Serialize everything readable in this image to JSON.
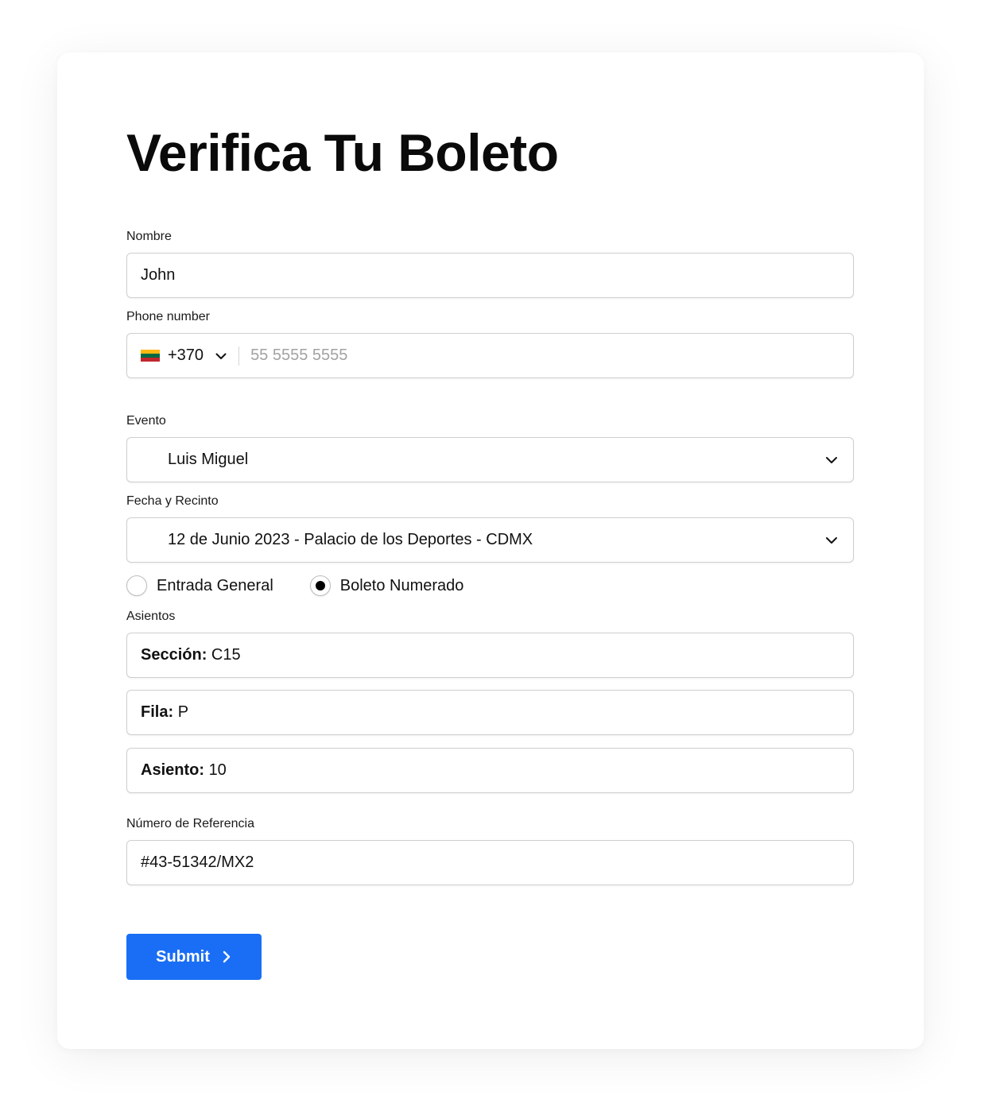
{
  "form": {
    "title": "Verifica Tu Boleto",
    "nombre": {
      "label": "Nombre",
      "value": "John"
    },
    "phone": {
      "label": "Phone number",
      "country_code": "+370",
      "flag_icon": "lithuania-flag-icon",
      "flag_colors": [
        "#fdb913",
        "#006a44",
        "#c1272d"
      ],
      "placeholder": "55 5555 5555"
    },
    "evento": {
      "label": "Evento",
      "value": "Luis Miguel"
    },
    "fecha": {
      "label": "Fecha y Recinto",
      "value": "12 de Junio 2023 - Palacio de los Deportes - CDMX"
    },
    "ticket_type": {
      "options": [
        {
          "label": "Entrada General",
          "selected": false
        },
        {
          "label": "Boleto Numerado",
          "selected": true
        }
      ]
    },
    "asientos": {
      "label": "Asientos",
      "seccion": {
        "key": "Sección:",
        "value": "C15"
      },
      "fila": {
        "key": "Fila:",
        "value": "P"
      },
      "asiento": {
        "key": "Asiento:",
        "value": "10"
      }
    },
    "referencia": {
      "label": "Número de Referencia",
      "value": "#43-51342/MX2"
    },
    "submit": {
      "label": "Submit",
      "icon": "chevron-right-icon"
    }
  },
  "colors": {
    "accent": "#1a6ef5",
    "border": "#cfcfcf",
    "placeholder": "#a2a2a2"
  }
}
